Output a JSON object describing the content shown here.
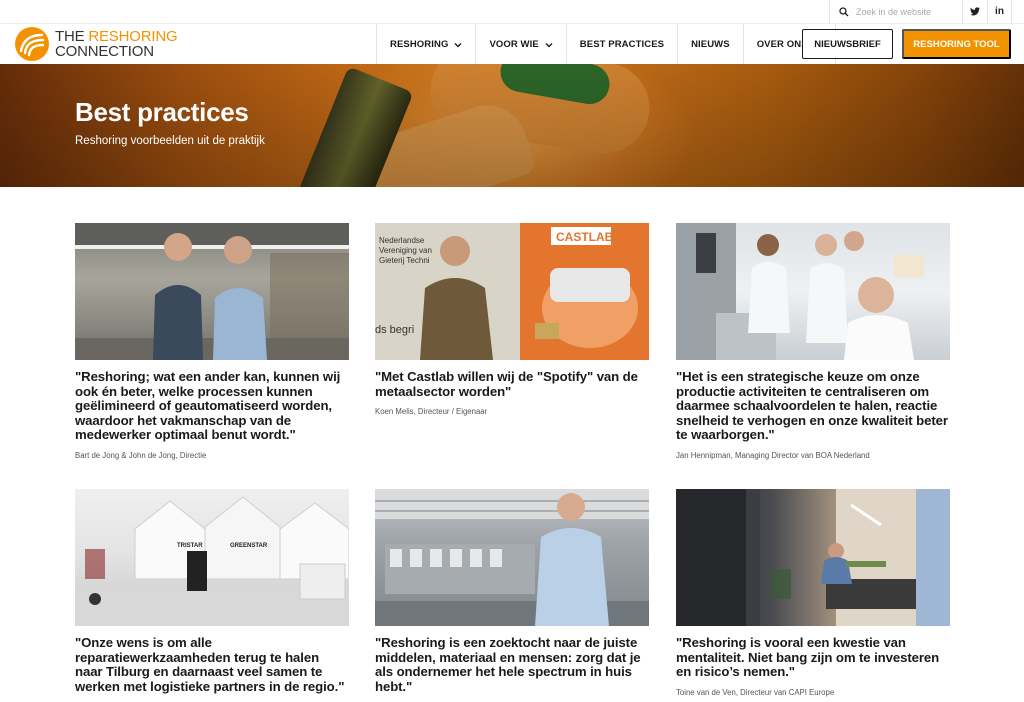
{
  "utility": {
    "search_placeholder": "Zoek in de website",
    "twitter_label": "t",
    "linkedin_label": "in"
  },
  "logo": {
    "line1_a": "THE ",
    "line1_b": "RESHORING",
    "line2": "CONNECTION"
  },
  "nav": {
    "items": [
      {
        "label": "RESHORING",
        "has_dropdown": true
      },
      {
        "label": "VOOR WIE",
        "has_dropdown": true
      },
      {
        "label": "BEST PRACTICES",
        "has_dropdown": false
      },
      {
        "label": "NIEUWS",
        "has_dropdown": false
      },
      {
        "label": "OVER ONS",
        "has_dropdown": true
      }
    ],
    "newsletter_button": "NIEUWSBRIEF",
    "tool_button": "RESHORING TOOL"
  },
  "hero": {
    "title": "Best practices",
    "subtitle": "Reshoring voorbeelden uit de praktijk"
  },
  "cards": [
    {
      "quote": "\"Reshoring; wat een ander kan, kunnen wij ook én beter, welke processen kunnen geëlimineerd of geautomatiseerd worden, waardoor het vakmanschap van de medewerker optimaal benut wordt.\"",
      "author": "Bart de Jong & John de Jong, Directie"
    },
    {
      "quote": "\"Met Castlab willen wij de \"Spotify\" van de metaalsector worden\"",
      "author": "Koen Melis, Directeur / Eigenaar"
    },
    {
      "quote": "\"Het is een strategische keuze om onze productie activiteiten te centraliseren om daarmee schaalvoordelen te halen, reactie snelheid te verhogen en onze kwaliteit beter te waarborgen.\"",
      "author": "Jan Hennipman, Managing Director van BOA Nederland"
    },
    {
      "quote": "\"Onze wens is om alle reparatiewerkzaamheden terug te halen naar Tilburg en daarnaast veel samen te werken met logistieke partners in de regio.\"",
      "author": ""
    },
    {
      "quote": "\"Reshoring is een zoektocht naar de juiste middelen, materiaal en mensen: zorg dat je als ondernemer het hele spectrum in huis hebt.\"",
      "author": ""
    },
    {
      "quote": "\"Reshoring is vooral een kwestie van mentaliteit. Niet bang zijn om te investeren en risico’s nemen.\"",
      "author": "Toine van de Ven, Directeur van CAPI Europe"
    }
  ],
  "image_text": {
    "castlab_logo": "CASTLAB",
    "castlab_banner": "Nederlandse Vereniging van Gieterij Techni",
    "castlab_side": "ds begri",
    "expo_sign1": "TRISTAR",
    "expo_sign2": "GREENSTAR"
  },
  "colors": {
    "accent": "#f39200",
    "text": "#1a1a1a"
  }
}
